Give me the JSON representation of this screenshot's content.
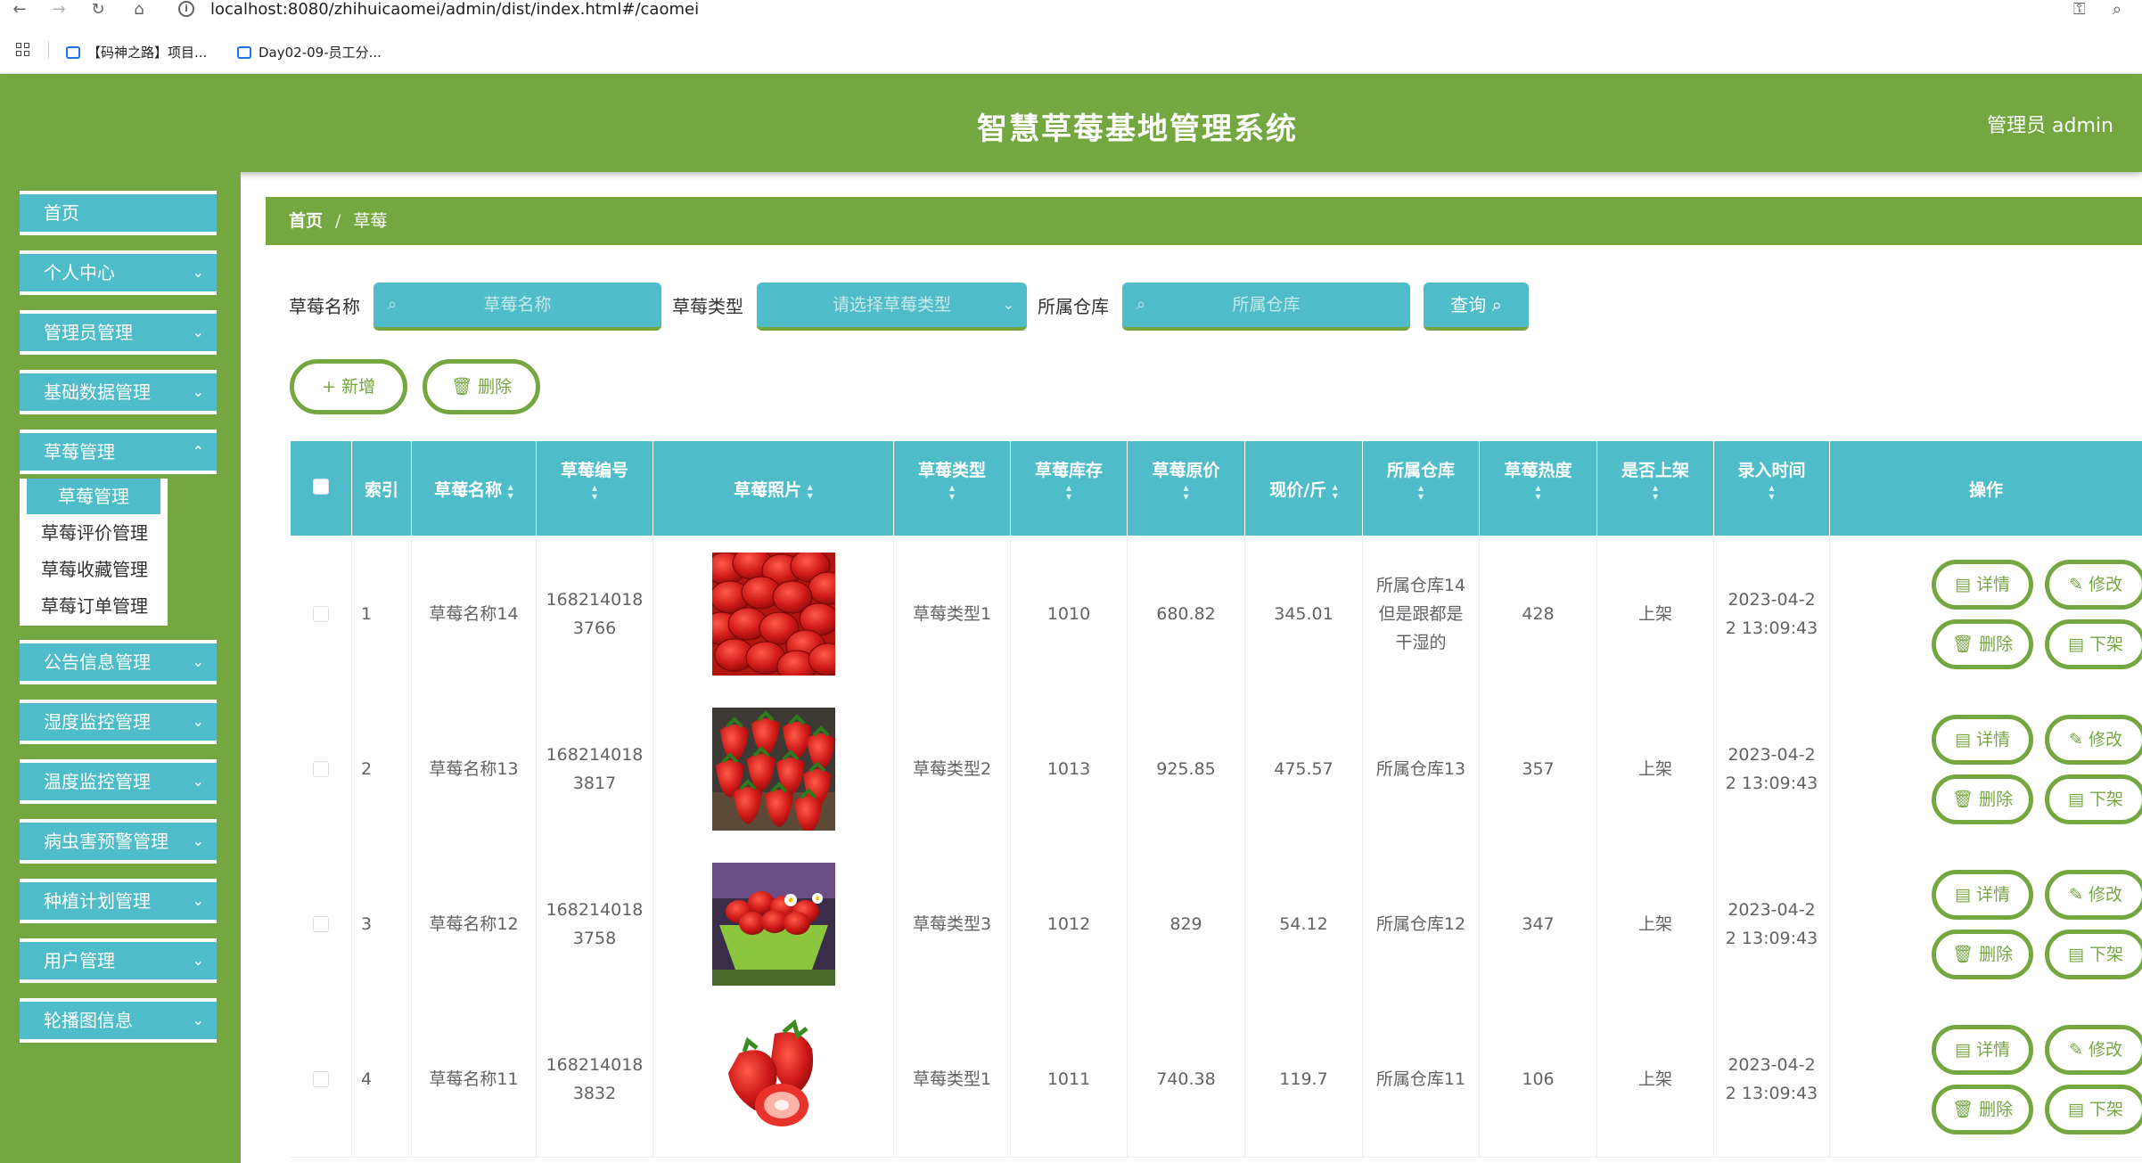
{
  "browser": {
    "url": "localhost:8080/zhihuicaomei/admin/dist/index.html#/caomei",
    "bookmarks": [
      {
        "label": "【码神之路】项目..."
      },
      {
        "label": "Day02-09-员工分..."
      }
    ]
  },
  "header": {
    "title": "智慧草莓基地管理系统",
    "user": "管理员 admin"
  },
  "sidebar": {
    "items": [
      {
        "label": "首页"
      },
      {
        "label": "个人中心"
      },
      {
        "label": "管理员管理"
      },
      {
        "label": "基础数据管理"
      },
      {
        "label": "草莓管理"
      },
      {
        "label": "公告信息管理"
      },
      {
        "label": "湿度监控管理"
      },
      {
        "label": "温度监控管理"
      },
      {
        "label": "病虫害预警管理"
      },
      {
        "label": "种植计划管理"
      },
      {
        "label": "用户管理"
      },
      {
        "label": "轮播图信息"
      }
    ],
    "submenu": [
      {
        "label": "草莓管理"
      },
      {
        "label": "草莓评价管理"
      },
      {
        "label": "草莓收藏管理"
      },
      {
        "label": "草莓订单管理"
      }
    ]
  },
  "breadcrumb": {
    "home": "首页",
    "separator": "/",
    "current": "草莓"
  },
  "search": {
    "name_label": "草莓名称",
    "name_placeholder": "草莓名称",
    "type_label": "草莓类型",
    "type_placeholder": "请选择草莓类型",
    "warehouse_label": "所属仓库",
    "warehouse_placeholder": "所属仓库",
    "query_label": "查询"
  },
  "actions": {
    "add_label": "新增",
    "delete_label": "删除"
  },
  "table": {
    "headers": {
      "index": "索引",
      "name": "草莓名称",
      "code": "草莓编号",
      "photo": "草莓照片",
      "type": "草莓类型",
      "stock": "草莓库存",
      "orig_price": "草莓原价",
      "price": "现价/斤",
      "warehouse": "所属仓库",
      "heat": "草莓热度",
      "listed": "是否上架",
      "time": "录入时间",
      "ops": "操作"
    },
    "row_buttons": {
      "detail": "详情",
      "edit": "修改",
      "delete": "删除",
      "offshelf": "下架"
    },
    "rows": [
      {
        "index": "1",
        "name": "草莓名称14",
        "code_a": "168214018",
        "code_b": "3766",
        "photo": "strawberry-pile",
        "type": "草莓类型1",
        "stock": "1010",
        "orig_price": "680.82",
        "price": "345.01",
        "warehouse": "所属仓库14但是跟都是干湿的",
        "heat": "428",
        "listed": "上架",
        "time_a": "2023-04-2",
        "time_b": "2 13:09:43"
      },
      {
        "index": "2",
        "name": "草莓名称13",
        "code_a": "168214018",
        "code_b": "3817",
        "photo": "strawberry-basket",
        "type": "草莓类型2",
        "stock": "1013",
        "orig_price": "925.85",
        "price": "475.57",
        "warehouse": "所属仓库13",
        "heat": "357",
        "listed": "上架",
        "time_a": "2023-04-2",
        "time_b": "2 13:09:43"
      },
      {
        "index": "3",
        "name": "草莓名称12",
        "code_a": "168214018",
        "code_b": "3758",
        "photo": "strawberry-bowl",
        "type": "草莓类型3",
        "stock": "1012",
        "orig_price": "829",
        "price": "54.12",
        "warehouse": "所属仓库12",
        "heat": "347",
        "listed": "上架",
        "time_a": "2023-04-2",
        "time_b": "2 13:09:43"
      },
      {
        "index": "4",
        "name": "草莓名称11",
        "code_a": "168214018",
        "code_b": "3832",
        "photo": "strawberry-cut",
        "type": "草莓类型1",
        "stock": "1011",
        "orig_price": "740.38",
        "price": "119.7",
        "warehouse": "所属仓库11",
        "heat": "106",
        "listed": "上架",
        "time_a": "2023-04-2",
        "time_b": "2 13:09:43"
      }
    ]
  },
  "colors": {
    "green": "#74a740",
    "teal": "#4fbcc9"
  }
}
